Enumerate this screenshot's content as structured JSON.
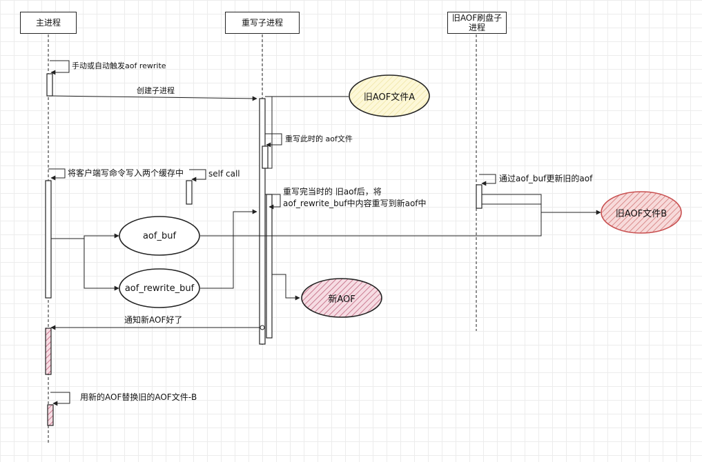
{
  "participants": {
    "main": "主进程",
    "rewrite": "重写子进程",
    "old_flush": "旧AOF刷盘子进程"
  },
  "messages": {
    "trigger": "手动或自动触发aof rewrite",
    "create_child": "创建子进程",
    "rewrite_current": "重写此时的 aof文件",
    "write_two_buffers": "将客户端写命令写入两个缓存中",
    "self_call": "self call",
    "rewrite_done_line1": "重写完当时的 旧aof后，将",
    "rewrite_done_line2": "aof_rewrite_buf中内容重写到新aof中",
    "update_old_aof": "通过aof_buf更新旧的aof",
    "notify_new_aof": "通知新AOF好了",
    "replace": "用新的AOF替换旧的AOF文件-B"
  },
  "nodes": {
    "old_aof_a": "旧AOF文件A",
    "aof_buf": "aof_buf",
    "aof_rewrite_buf": "aof_rewrite_buf",
    "new_aof": "新AOF",
    "old_aof_b": "旧AOF文件B"
  },
  "colors": {
    "line": "#222222",
    "grid": "#ececec",
    "file_a_fill": "#fbf6cf",
    "new_aof_fill": "#e9b8c4",
    "file_b_fill": "#f3c5c5",
    "file_b_border": "#c85050"
  }
}
